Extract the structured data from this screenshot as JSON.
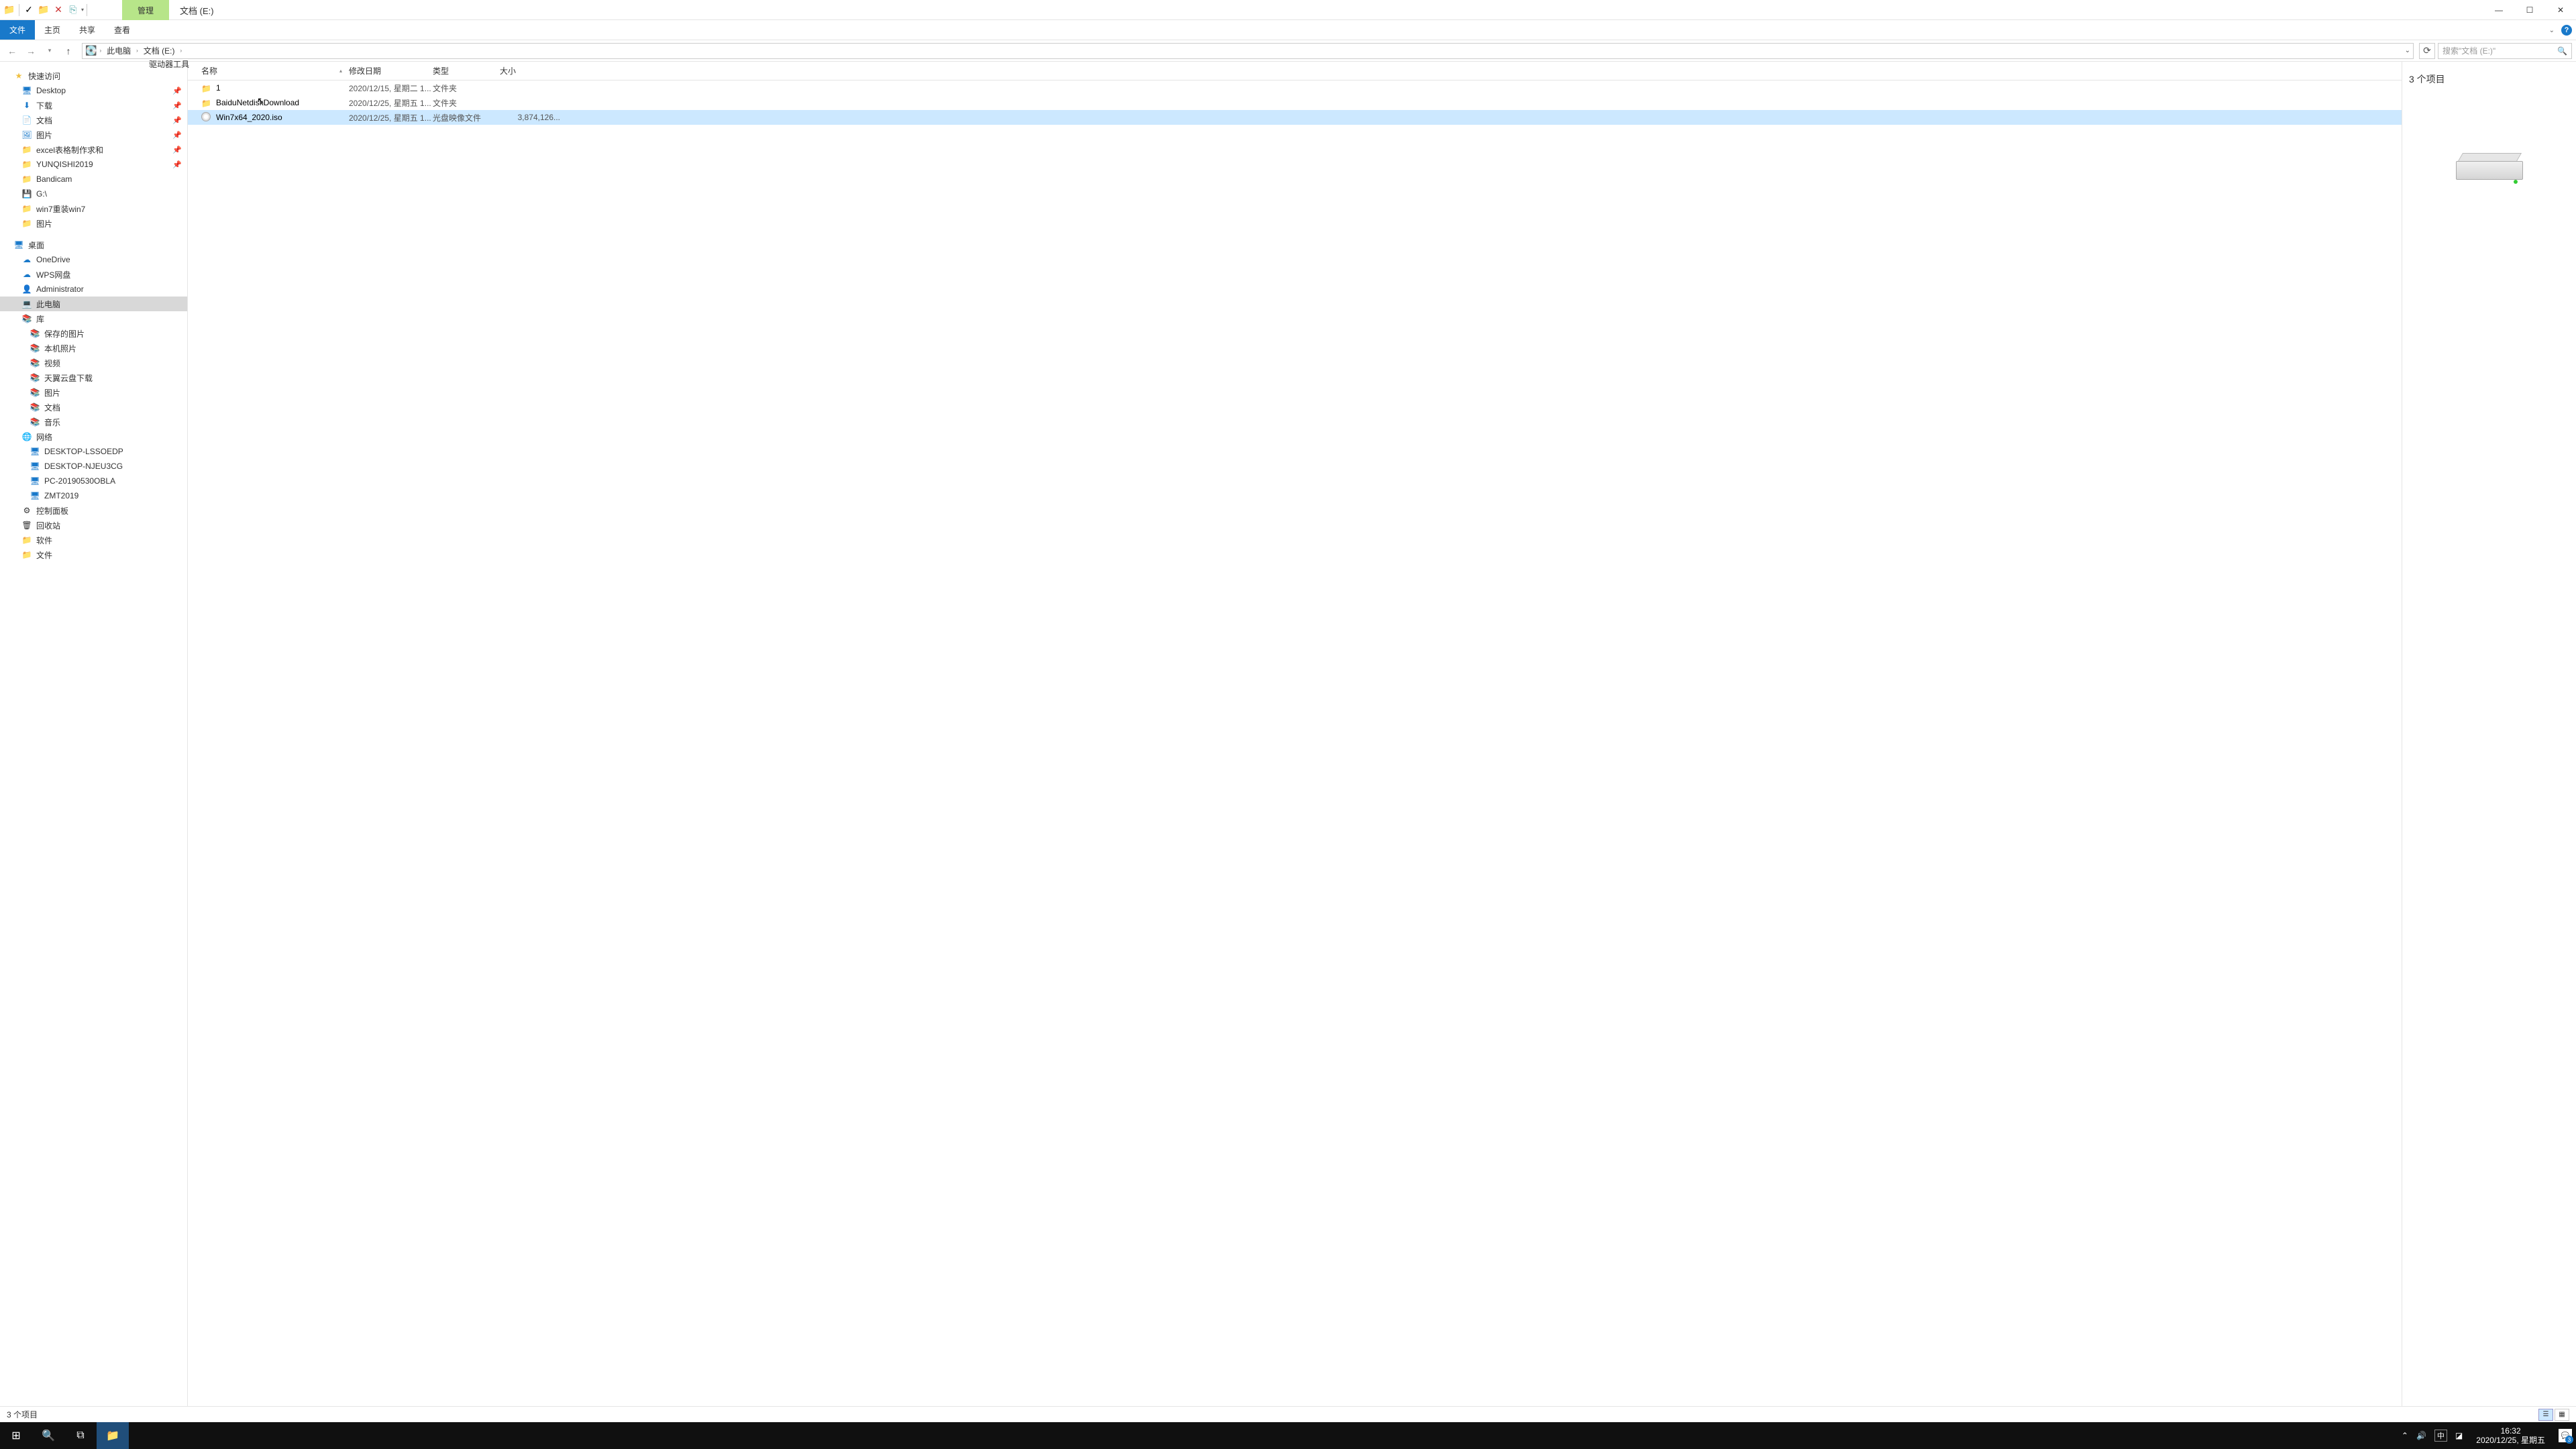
{
  "title_tab_context": "管理",
  "title_location": "文档 (E:)",
  "ribbon": {
    "file": "文件",
    "home": "主页",
    "share": "共享",
    "view": "查看",
    "drive": "驱动器工具"
  },
  "breadcrumb": {
    "pc": "此电脑",
    "loc": "文档 (E:)"
  },
  "search_placeholder": "搜索\"文档 (E:)\"",
  "columns": {
    "name": "名称",
    "date": "修改日期",
    "type": "类型",
    "size": "大小"
  },
  "rows": [
    {
      "icon": "folder",
      "name": "1",
      "date": "2020/12/15, 星期二 1...",
      "type": "文件夹",
      "size": ""
    },
    {
      "icon": "folder",
      "name": "BaiduNetdiskDownload",
      "date": "2020/12/25, 星期五 1...",
      "type": "文件夹",
      "size": ""
    },
    {
      "icon": "disc",
      "name": "Win7x64_2020.iso",
      "date": "2020/12/25, 星期五 1...",
      "type": "光盘映像文件",
      "size": "3,874,126..."
    }
  ],
  "tree": [
    {
      "kind": "item",
      "depth": 0,
      "icon": "star",
      "label": "快速访问"
    },
    {
      "kind": "item",
      "depth": 1,
      "icon": "desk",
      "label": "Desktop",
      "pin": true
    },
    {
      "kind": "item",
      "depth": 1,
      "icon": "dl",
      "label": "下载",
      "pin": true
    },
    {
      "kind": "item",
      "depth": 1,
      "icon": "doc",
      "label": "文档",
      "pin": true
    },
    {
      "kind": "item",
      "depth": 1,
      "icon": "pic",
      "label": "图片",
      "pin": true
    },
    {
      "kind": "item",
      "depth": 1,
      "icon": "fold",
      "label": "excel表格制作求和",
      "pin": true
    },
    {
      "kind": "item",
      "depth": 1,
      "icon": "fold",
      "label": "YUNQISHI2019",
      "pin": true
    },
    {
      "kind": "item",
      "depth": 1,
      "icon": "fold",
      "label": "Bandicam"
    },
    {
      "kind": "item",
      "depth": 1,
      "icon": "usb",
      "label": "G:\\"
    },
    {
      "kind": "item",
      "depth": 1,
      "icon": "fold",
      "label": "win7重装win7"
    },
    {
      "kind": "item",
      "depth": 1,
      "icon": "fold",
      "label": "图片"
    },
    {
      "kind": "spacer"
    },
    {
      "kind": "item",
      "depth": 0,
      "icon": "desk",
      "label": "桌面"
    },
    {
      "kind": "item",
      "depth": 1,
      "icon": "cloud",
      "label": "OneDrive"
    },
    {
      "kind": "item",
      "depth": 1,
      "icon": "cloud",
      "label": "WPS网盘"
    },
    {
      "kind": "item",
      "depth": 1,
      "icon": "user",
      "label": "Administrator"
    },
    {
      "kind": "item",
      "depth": 1,
      "icon": "pc",
      "label": "此电脑",
      "selected": true
    },
    {
      "kind": "item",
      "depth": 1,
      "icon": "lib",
      "label": "库"
    },
    {
      "kind": "item",
      "depth": 2,
      "icon": "lib",
      "label": "保存的图片"
    },
    {
      "kind": "item",
      "depth": 2,
      "icon": "lib",
      "label": "本机照片"
    },
    {
      "kind": "item",
      "depth": 2,
      "icon": "lib",
      "label": "视频"
    },
    {
      "kind": "item",
      "depth": 2,
      "icon": "lib",
      "label": "天翼云盘下载"
    },
    {
      "kind": "item",
      "depth": 2,
      "icon": "lib",
      "label": "图片"
    },
    {
      "kind": "item",
      "depth": 2,
      "icon": "lib",
      "label": "文档"
    },
    {
      "kind": "item",
      "depth": 2,
      "icon": "lib",
      "label": "音乐"
    },
    {
      "kind": "item",
      "depth": 1,
      "icon": "net",
      "label": "网络"
    },
    {
      "kind": "item",
      "depth": 2,
      "icon": "npc",
      "label": "DESKTOP-LSSOEDP"
    },
    {
      "kind": "item",
      "depth": 2,
      "icon": "npc",
      "label": "DESKTOP-NJEU3CG"
    },
    {
      "kind": "item",
      "depth": 2,
      "icon": "npc",
      "label": "PC-20190530OBLA"
    },
    {
      "kind": "item",
      "depth": 2,
      "icon": "npc",
      "label": "ZMT2019"
    },
    {
      "kind": "item",
      "depth": 1,
      "icon": "cpl",
      "label": "控制面板"
    },
    {
      "kind": "item",
      "depth": 1,
      "icon": "bin",
      "label": "回收站"
    },
    {
      "kind": "item",
      "depth": 1,
      "icon": "fold",
      "label": "软件"
    },
    {
      "kind": "item",
      "depth": 1,
      "icon": "fold",
      "label": "文件"
    }
  ],
  "preview_count": "3 个项目",
  "status_text": "3 个项目",
  "tray": {
    "ime": "中",
    "time": "16:32",
    "date": "2020/12/25, 星期五",
    "badge": "3"
  }
}
